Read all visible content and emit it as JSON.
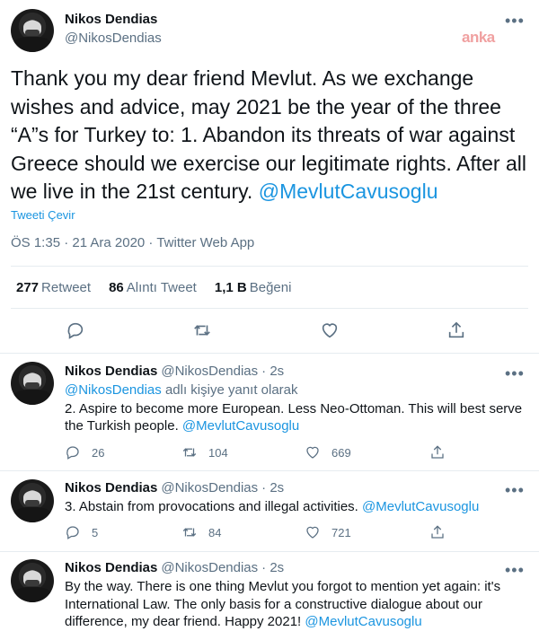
{
  "watermark": "anka",
  "main_tweet": {
    "name": "Nikos Dendias",
    "handle": "@NikosDendias",
    "text": "Thank you my dear friend Mevlut. As we exchange wishes and advice, may 2021 be the year of the three “A”s for Turkey to: 1. Abandon its threats of war against Greece should we exercise our legitimate rights. After all we live in the 21st century. ",
    "mention": "@MevlutCavusoglu",
    "translate_label": "Tweeti Çevir",
    "meta": "ÖS 1:35 · 21 Ara 2020 · Twitter Web App",
    "stats": {
      "retweets_count": "277",
      "retweets_label": "Retweet",
      "quotes_count": "86",
      "quotes_label": "Alıntı Tweet",
      "likes_count": "1,1 B",
      "likes_label": "Beğeni"
    },
    "actions": [
      "reply-icon",
      "retweet-icon",
      "like-icon",
      "share-icon"
    ]
  },
  "replies": [
    {
      "name": "Nikos Dendias",
      "handle": "@NikosDendias",
      "time": "· 2s",
      "replying_to_handle": "@NikosDendias",
      "replying_to_suffix": " adlı kişiye yanıt olarak",
      "text": "2. Aspire to become more European. Less Neo-Ottoman. This will best serve the Turkish people. ",
      "mention": "@MevlutCavusoglu",
      "replies": "26",
      "retweets": "104",
      "likes": "669"
    },
    {
      "name": "Nikos Dendias",
      "handle": "@NikosDendias",
      "time": "· 2s",
      "text": "3. Abstain from provocations and illegal activities. ",
      "mention": "@MevlutCavusoglu",
      "replies": "5",
      "retweets": "84",
      "likes": "721"
    },
    {
      "name": "Nikos Dendias",
      "handle": "@NikosDendias",
      "time": "· 2s",
      "text": "By the way. There is one thing Mevlut you forgot to mention yet again: it's International Law. The only basis for a constructive dialogue about our difference, my dear friend. Happy 2021! ",
      "mention": "@MevlutCavusoglu"
    }
  ],
  "colors": {
    "link": "#1b95e0",
    "muted": "#5b7083",
    "text": "#0f1419",
    "border": "#e6ecf0"
  }
}
